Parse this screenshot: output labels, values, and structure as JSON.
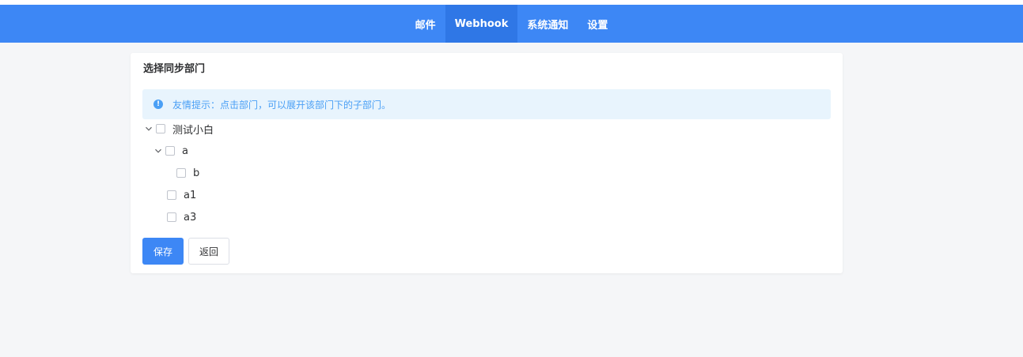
{
  "nav": {
    "items": [
      {
        "label": "邮件"
      },
      {
        "label": "Webhook"
      },
      {
        "label": "系统通知"
      },
      {
        "label": "设置"
      }
    ]
  },
  "card": {
    "title": "选择同步部门",
    "alert": "友情提示：点击部门，可以展开该部门下的子部门。",
    "tree": [
      {
        "label": "测试小白",
        "level": 0,
        "expanded": true,
        "checked": false
      },
      {
        "label": "a",
        "level": 1,
        "expanded": true,
        "checked": false
      },
      {
        "label": "b",
        "level": 2,
        "expanded": false,
        "checked": false
      },
      {
        "label": "a1",
        "level": 1,
        "expanded": false,
        "checked": false
      },
      {
        "label": "a3",
        "level": 1,
        "expanded": false,
        "checked": false
      }
    ],
    "save_label": "保存",
    "back_label": "返回"
  }
}
